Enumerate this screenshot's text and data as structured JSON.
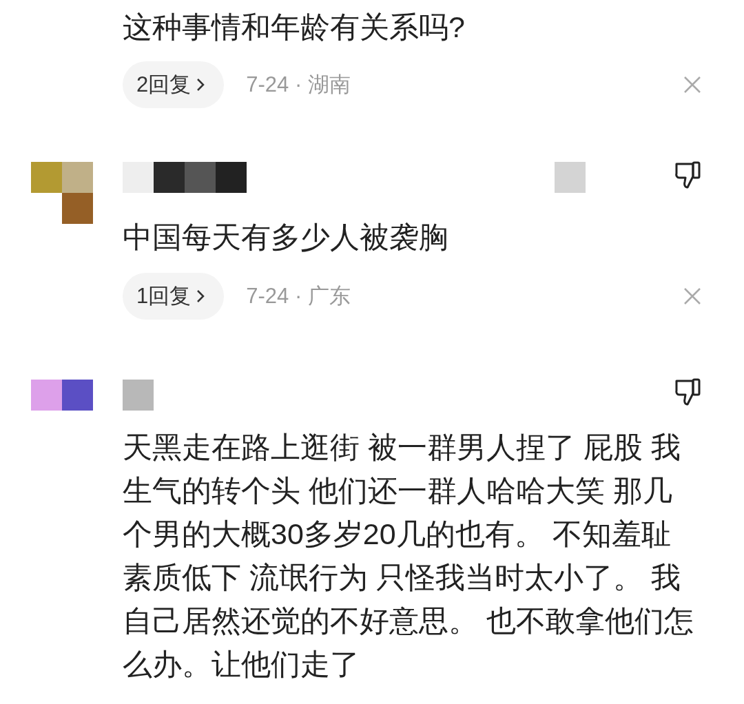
{
  "comments": [
    {
      "kind": "cut",
      "text": "这种事情和年龄有关系吗?",
      "replies": "2回复",
      "meta": "7-24 · 湖南"
    },
    {
      "kind": "full",
      "text": "中国每天有多少人被袭胸",
      "replies": "1回复",
      "meta": "7-24 · 广东"
    },
    {
      "kind": "full",
      "text": "天黑走在路上逛街 被一群男人捏了 屁股 我生气的转个头 他们还一群人哈哈大笑 那几个男的大概30多岁20几的也有。 不知羞耻素质低下 流氓行为 只怪我当时太小了。 我自己居然还觉的不好意思。 也不敢拿他们怎么办。让他们走了"
    }
  ]
}
